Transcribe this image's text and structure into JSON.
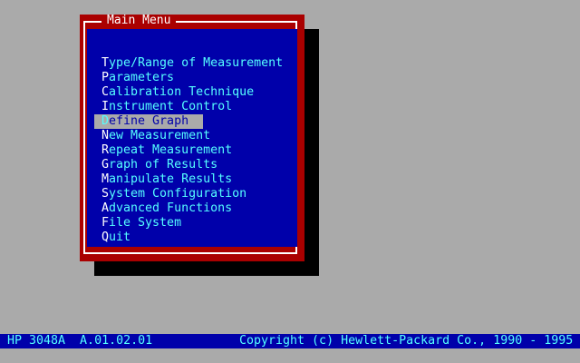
{
  "menu": {
    "title": "Main Menu",
    "selected_index": 4,
    "items": [
      {
        "hotkey": "T",
        "rest": "ype/Range of Measurement"
      },
      {
        "hotkey": "P",
        "rest": "arameters"
      },
      {
        "hotkey": "C",
        "rest": "alibration Technique"
      },
      {
        "hotkey": "I",
        "rest": "nstrument Control"
      },
      {
        "hotkey": "D",
        "rest": "efine Graph"
      },
      {
        "hotkey": "N",
        "rest": "ew Measurement"
      },
      {
        "hotkey": "R",
        "rest": "epeat Measurement"
      },
      {
        "hotkey": "G",
        "rest": "raph of Results"
      },
      {
        "hotkey": "M",
        "rest": "anipulate Results"
      },
      {
        "hotkey": "S",
        "rest": "ystem Configuration"
      },
      {
        "hotkey": "A",
        "rest": "dvanced Functions"
      },
      {
        "hotkey": "F",
        "rest": "ile System"
      },
      {
        "hotkey": "Q",
        "rest": "uit"
      }
    ]
  },
  "status_bar": {
    "left": "HP 3048A  A.01.02.01",
    "right": "Copyright (c) Hewlett-Packard Co., 1990 - 1995"
  },
  "colors": {
    "desktop": "#aaaaaa",
    "window_frame": "#aa0000",
    "window_body": "#0000aa",
    "menu_text": "#55ffff",
    "hotkey_text": "#ffffff",
    "selection_bg": "#aaaaaa",
    "status_bg": "#0000aa"
  }
}
